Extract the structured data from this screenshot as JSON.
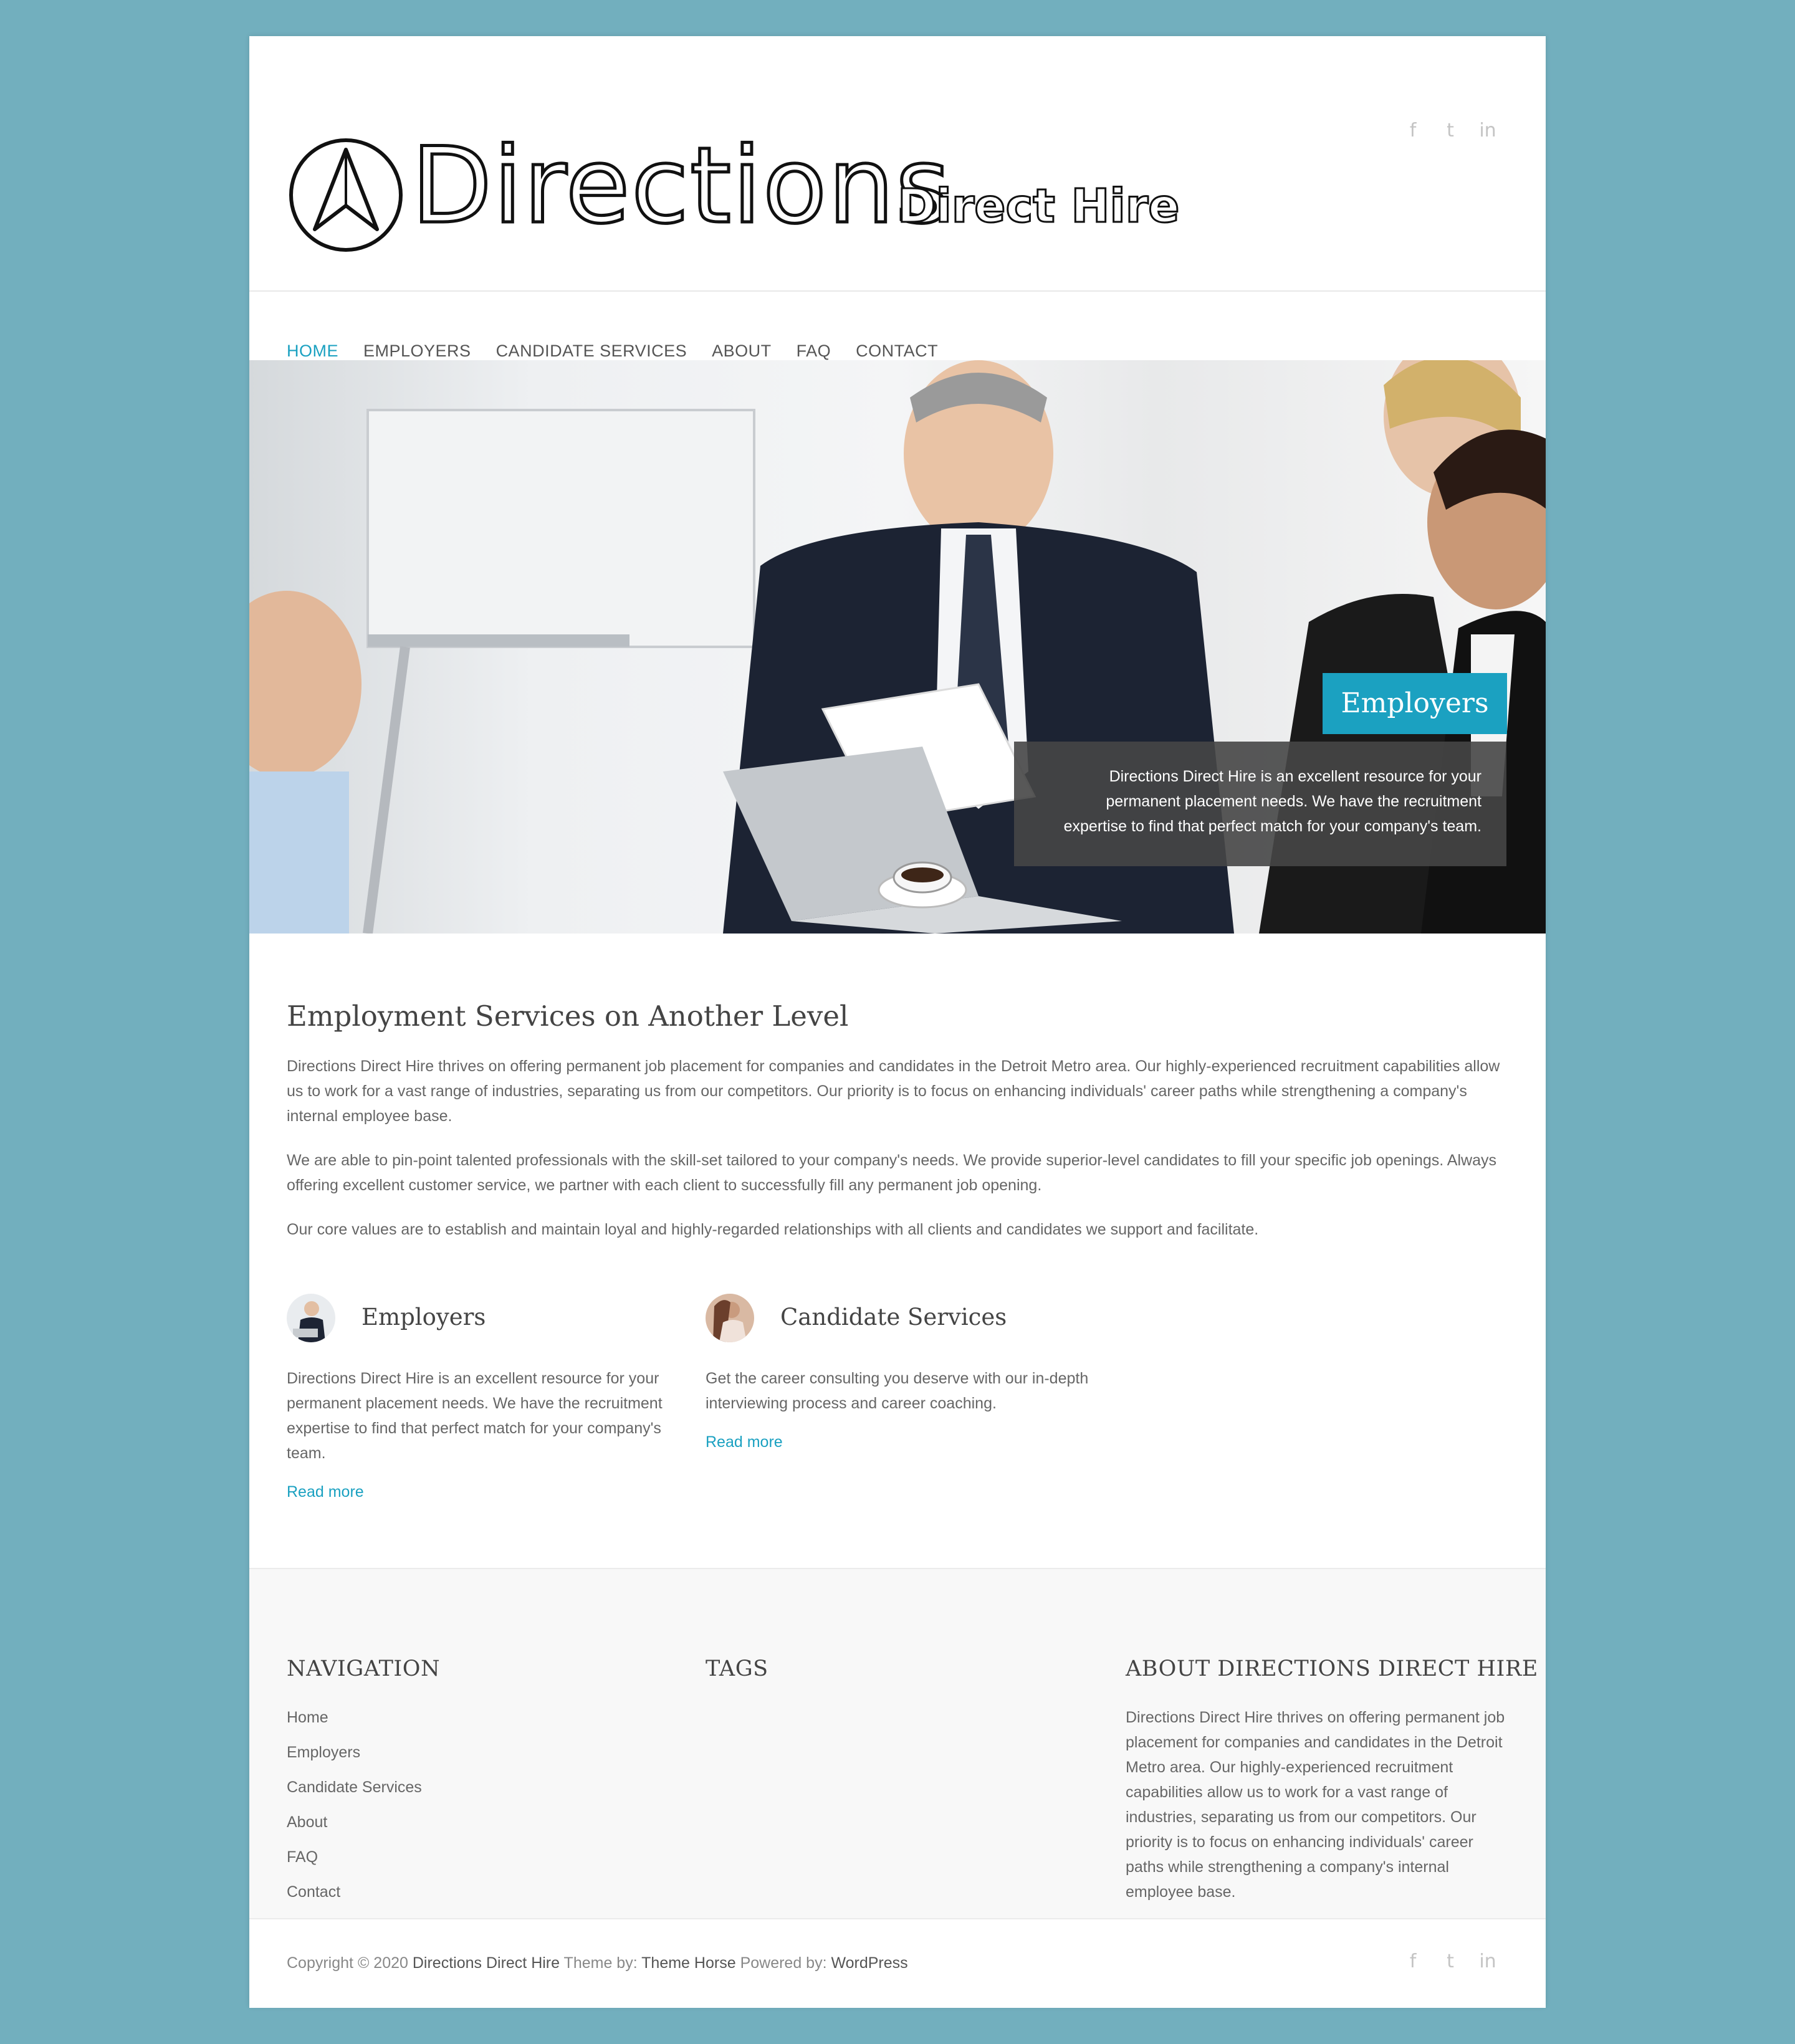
{
  "site": {
    "logo_text": "Directions",
    "logo_subtext": "Direct Hire"
  },
  "social": {
    "facebook": "f",
    "twitter": "t",
    "linkedin": "in"
  },
  "nav": {
    "items": [
      {
        "label": "HOME",
        "active": true
      },
      {
        "label": "EMPLOYERS"
      },
      {
        "label": "CANDIDATE SERVICES"
      },
      {
        "label": "ABOUT"
      },
      {
        "label": "FAQ"
      },
      {
        "label": "CONTACT"
      }
    ]
  },
  "hero": {
    "badge": "Employers",
    "caption": "Directions Direct Hire is an excellent resource for your permanent placement needs. We have the recruitment expertise to find that perfect match for your company's team.",
    "slides_count": 2,
    "active_slide": 1
  },
  "main": {
    "heading": "Employment Services on Another Level",
    "paragraphs": [
      "Directions Direct Hire thrives on offering permanent job placement for companies and candidates in the Detroit Metro area. Our highly-experienced recruitment capabilities allow us to work for a vast range of industries, separating us from our competitors. Our priority is to focus on enhancing individuals' career paths while strengthening a company's internal employee base.",
      "We are able to pin-point talented professionals with the skill-set tailored to your company's needs. We provide superior-level candidates to fill your specific job openings. Always offering excellent customer service, we partner with each client to successfully fill any permanent job opening.",
      "Our core values are to establish and maintain loyal and highly-regarded relationships with all clients and candidates we support and facilitate."
    ]
  },
  "features": [
    {
      "title": "Employers",
      "text": "Directions Direct Hire is an excellent resource for your permanent placement needs. We have the recruitment expertise to find that perfect match for your company's team.",
      "link": "Read more"
    },
    {
      "title": "Candidate Services",
      "text": "Get the career consulting you deserve with our in-depth interviewing process and career coaching.",
      "link": "Read more"
    }
  ],
  "footer": {
    "navigation": {
      "title": "NAVIGATION",
      "items": [
        "Home",
        "Employers",
        "Candidate Services",
        "About",
        "FAQ",
        "Contact"
      ]
    },
    "tags": {
      "title": "TAGS"
    },
    "about": {
      "title": "ABOUT DIRECTIONS DIRECT HIRE",
      "text": "Directions Direct Hire thrives on offering permanent job placement for companies and candidates in the Detroit Metro area. Our highly-experienced recruitment capabilities allow us to work for a vast range of industries, separating us from our competitors. Our priority is to focus on enhancing individuals' career paths while strengthening a company's internal employee base."
    }
  },
  "bottom": {
    "copyright_prefix": "Copyright © 2020",
    "site_link": "Directions Direct Hire",
    "theme_prefix": "Theme by:",
    "theme_link": "Theme Horse",
    "powered_prefix": "Powered by:",
    "powered_link": "WordPress"
  },
  "colors": {
    "accent": "#1ba1c1",
    "background": "#72afbe",
    "text": "#555555"
  }
}
